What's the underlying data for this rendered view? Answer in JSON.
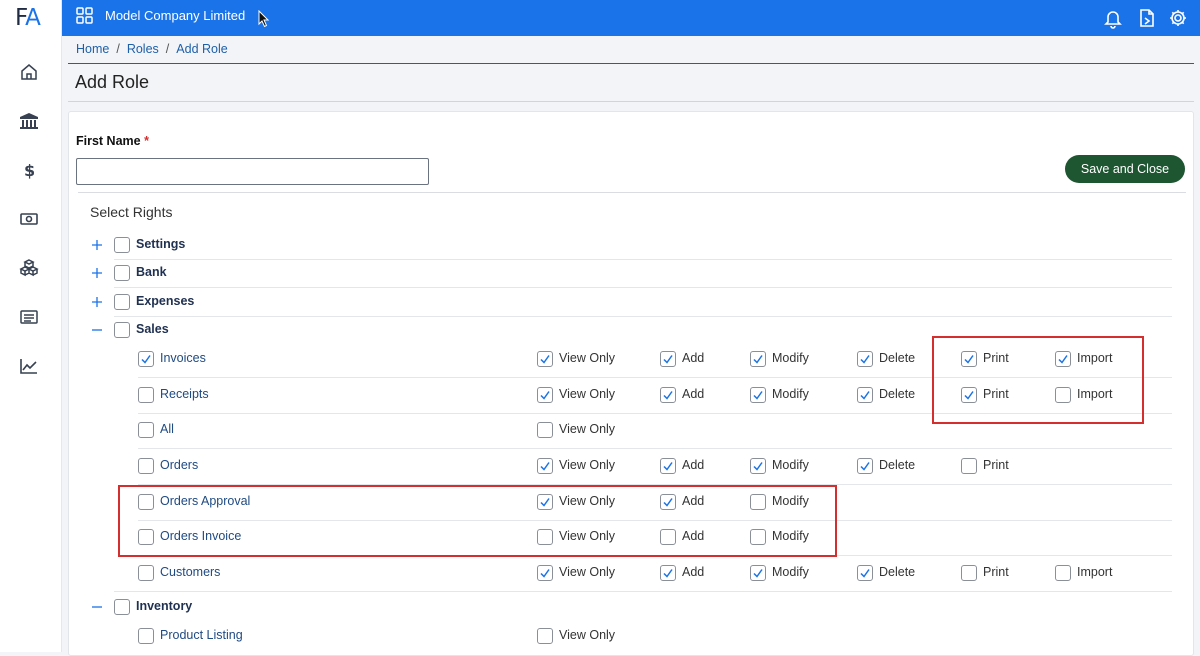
{
  "sidebar": {
    "logo_f": "F",
    "logo_a": "A",
    "icons": [
      "home-icon",
      "bank-icon",
      "dollar-icon",
      "cash-icon",
      "boxes-icon",
      "list-icon",
      "chart-icon"
    ]
  },
  "topbar": {
    "company": "Model Company Limited",
    "icons": [
      "apps-grid-icon",
      "bell-icon",
      "document-arrow-icon",
      "gear-icon"
    ],
    "color": "#1a73e8"
  },
  "breadcrumb": {
    "home": "Home",
    "sep": "/",
    "roles": "Roles",
    "current": "Add Role"
  },
  "page": {
    "title": "Add Role"
  },
  "form": {
    "first_name_label": "First Name",
    "required_mark": "*",
    "first_name_value": "",
    "save_label": "Save and Close"
  },
  "rights": {
    "label": "Select Rights",
    "perm_labels": {
      "view": "View Only",
      "add": "Add",
      "modify": "Modify",
      "delete": "Delete",
      "print": "Print",
      "import": "Import"
    },
    "categories": [
      {
        "label": "Settings",
        "expander": "+",
        "checked": false
      },
      {
        "label": "Bank",
        "expander": "+",
        "checked": false
      },
      {
        "label": "Expenses",
        "expander": "+",
        "checked": false
      },
      {
        "label": "Sales",
        "expander": "−",
        "checked": false
      },
      {
        "label": "Inventory",
        "expander": "−",
        "checked": false
      }
    ],
    "sales_items": [
      {
        "label": "Invoices",
        "checked": true,
        "perms": {
          "view": true,
          "add": true,
          "modify": true,
          "delete": true,
          "print": true,
          "import": true
        }
      },
      {
        "label": "Receipts",
        "checked": false,
        "perms": {
          "view": true,
          "add": true,
          "modify": true,
          "delete": true,
          "print": true,
          "import": false
        }
      },
      {
        "label": "All",
        "checked": false,
        "perms": {
          "view": false
        }
      },
      {
        "label": "Orders",
        "checked": false,
        "perms": {
          "view": true,
          "add": true,
          "modify": true,
          "delete": true,
          "print": false
        }
      },
      {
        "label": "Orders Approval",
        "checked": false,
        "perms": {
          "view": true,
          "add": true,
          "modify": false
        }
      },
      {
        "label": "Orders Invoice",
        "checked": false,
        "perms": {
          "view": false,
          "add": false,
          "modify": false
        }
      },
      {
        "label": "Customers",
        "checked": false,
        "perms": {
          "view": true,
          "add": true,
          "modify": true,
          "delete": true,
          "print": false,
          "import": false
        }
      }
    ],
    "inventory_items": [
      {
        "label": "Product Listing",
        "checked": false,
        "perms": {
          "view": false
        }
      }
    ]
  },
  "highlight_color": "#d32f2f"
}
